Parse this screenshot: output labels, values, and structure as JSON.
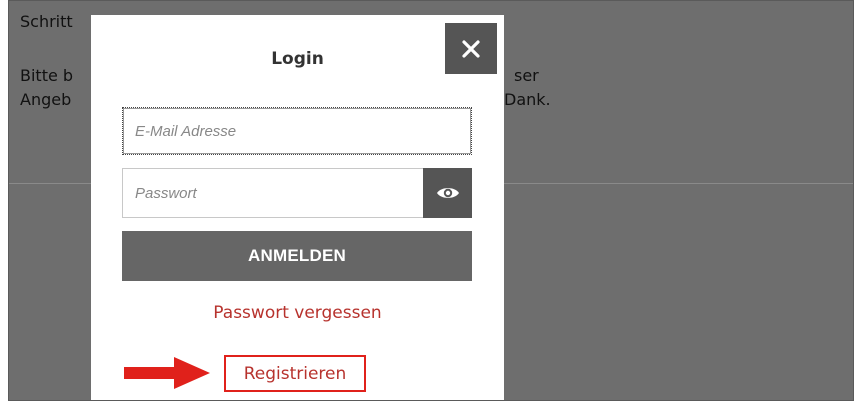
{
  "background": {
    "line1": "Schritt",
    "line2_left": "Bitte b",
    "line2_right": "ser",
    "line3_left": "Angeb",
    "line3_right": "Dank."
  },
  "modal": {
    "title": "Login",
    "close_icon": "close-icon",
    "email_placeholder": "E-Mail Adresse",
    "password_placeholder": "Passwort",
    "eye_icon": "eye-icon",
    "login_label": "ANMELDEN",
    "forgot_label": "Passwort vergessen",
    "register_label": "Registrieren"
  },
  "annotation": {
    "arrow_icon": "arrow-right-icon",
    "arrow_color": "#e0211b",
    "highlight_color": "#e0211b"
  },
  "colors": {
    "overlay": "#6e6e6e",
    "button": "#555555",
    "link": "#b7322d"
  }
}
